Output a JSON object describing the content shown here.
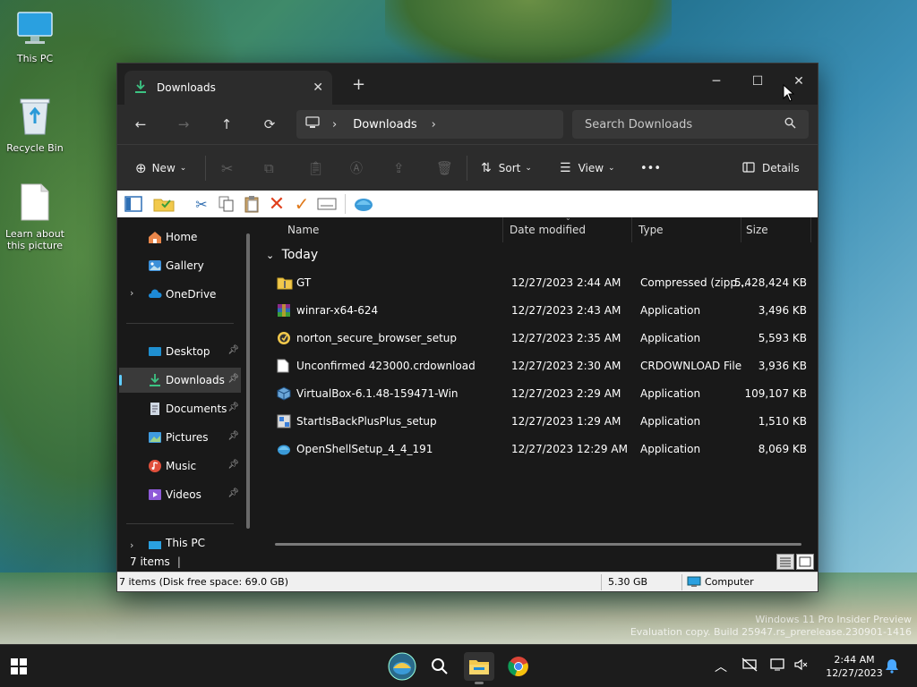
{
  "desktop": {
    "icons": [
      {
        "label": "This PC"
      },
      {
        "label": "Recycle Bin"
      },
      {
        "label": "Learn about this picture"
      }
    ],
    "watermark_line1": "Windows 11 Pro Insider Preview",
    "watermark_line2": "Evaluation copy. Build 25947.rs_prerelease.230901-1416"
  },
  "window": {
    "tab_title": "Downloads",
    "address_location": "Downloads",
    "search_placeholder": "Search Downloads",
    "cmd": {
      "new": "New",
      "sort": "Sort",
      "view": "View",
      "more": "•••",
      "details": "Details"
    },
    "nav": {
      "items": [
        {
          "label": "Home"
        },
        {
          "label": "Gallery"
        },
        {
          "label": "OneDrive"
        },
        {
          "label": "Desktop"
        },
        {
          "label": "Downloads"
        },
        {
          "label": "Documents"
        },
        {
          "label": "Pictures"
        },
        {
          "label": "Music"
        },
        {
          "label": "Videos"
        },
        {
          "label": "This PC"
        }
      ]
    },
    "columns": {
      "name": "Name",
      "date": "Date modified",
      "type": "Type",
      "size": "Size"
    },
    "group": "Today",
    "files": [
      {
        "name": "GT",
        "date": "12/27/2023 2:44 AM",
        "type": "Compressed (zipp...",
        "size": "5,428,424 KB"
      },
      {
        "name": "winrar-x64-624",
        "date": "12/27/2023 2:43 AM",
        "type": "Application",
        "size": "3,496 KB"
      },
      {
        "name": "norton_secure_browser_setup",
        "date": "12/27/2023 2:35 AM",
        "type": "Application",
        "size": "5,593 KB"
      },
      {
        "name": "Unconfirmed 423000.crdownload",
        "date": "12/27/2023 2:30 AM",
        "type": "CRDOWNLOAD File",
        "size": "3,936 KB"
      },
      {
        "name": "VirtualBox-6.1.48-159471-Win",
        "date": "12/27/2023 2:29 AM",
        "type": "Application",
        "size": "109,107 KB"
      },
      {
        "name": "StartIsBackPlusPlus_setup",
        "date": "12/27/2023 1:29 AM",
        "type": "Application",
        "size": "1,510 KB"
      },
      {
        "name": "OpenShellSetup_4_4_191",
        "date": "12/27/2023 12:29 AM",
        "type": "Application",
        "size": "8,069 KB"
      }
    ],
    "status_items": "7 items",
    "status_bar": {
      "left": "7 items (Disk free space: 69.0 GB)",
      "size": "5.30 GB",
      "location": "Computer"
    }
  },
  "taskbar": {
    "time": "2:44 AM",
    "date": "12/27/2023"
  },
  "colors": {
    "accent": "#60cdff",
    "window_bg": "#191919",
    "chrome_bg": "#2c2c2c",
    "folder_yellow": "#f2c94c"
  }
}
